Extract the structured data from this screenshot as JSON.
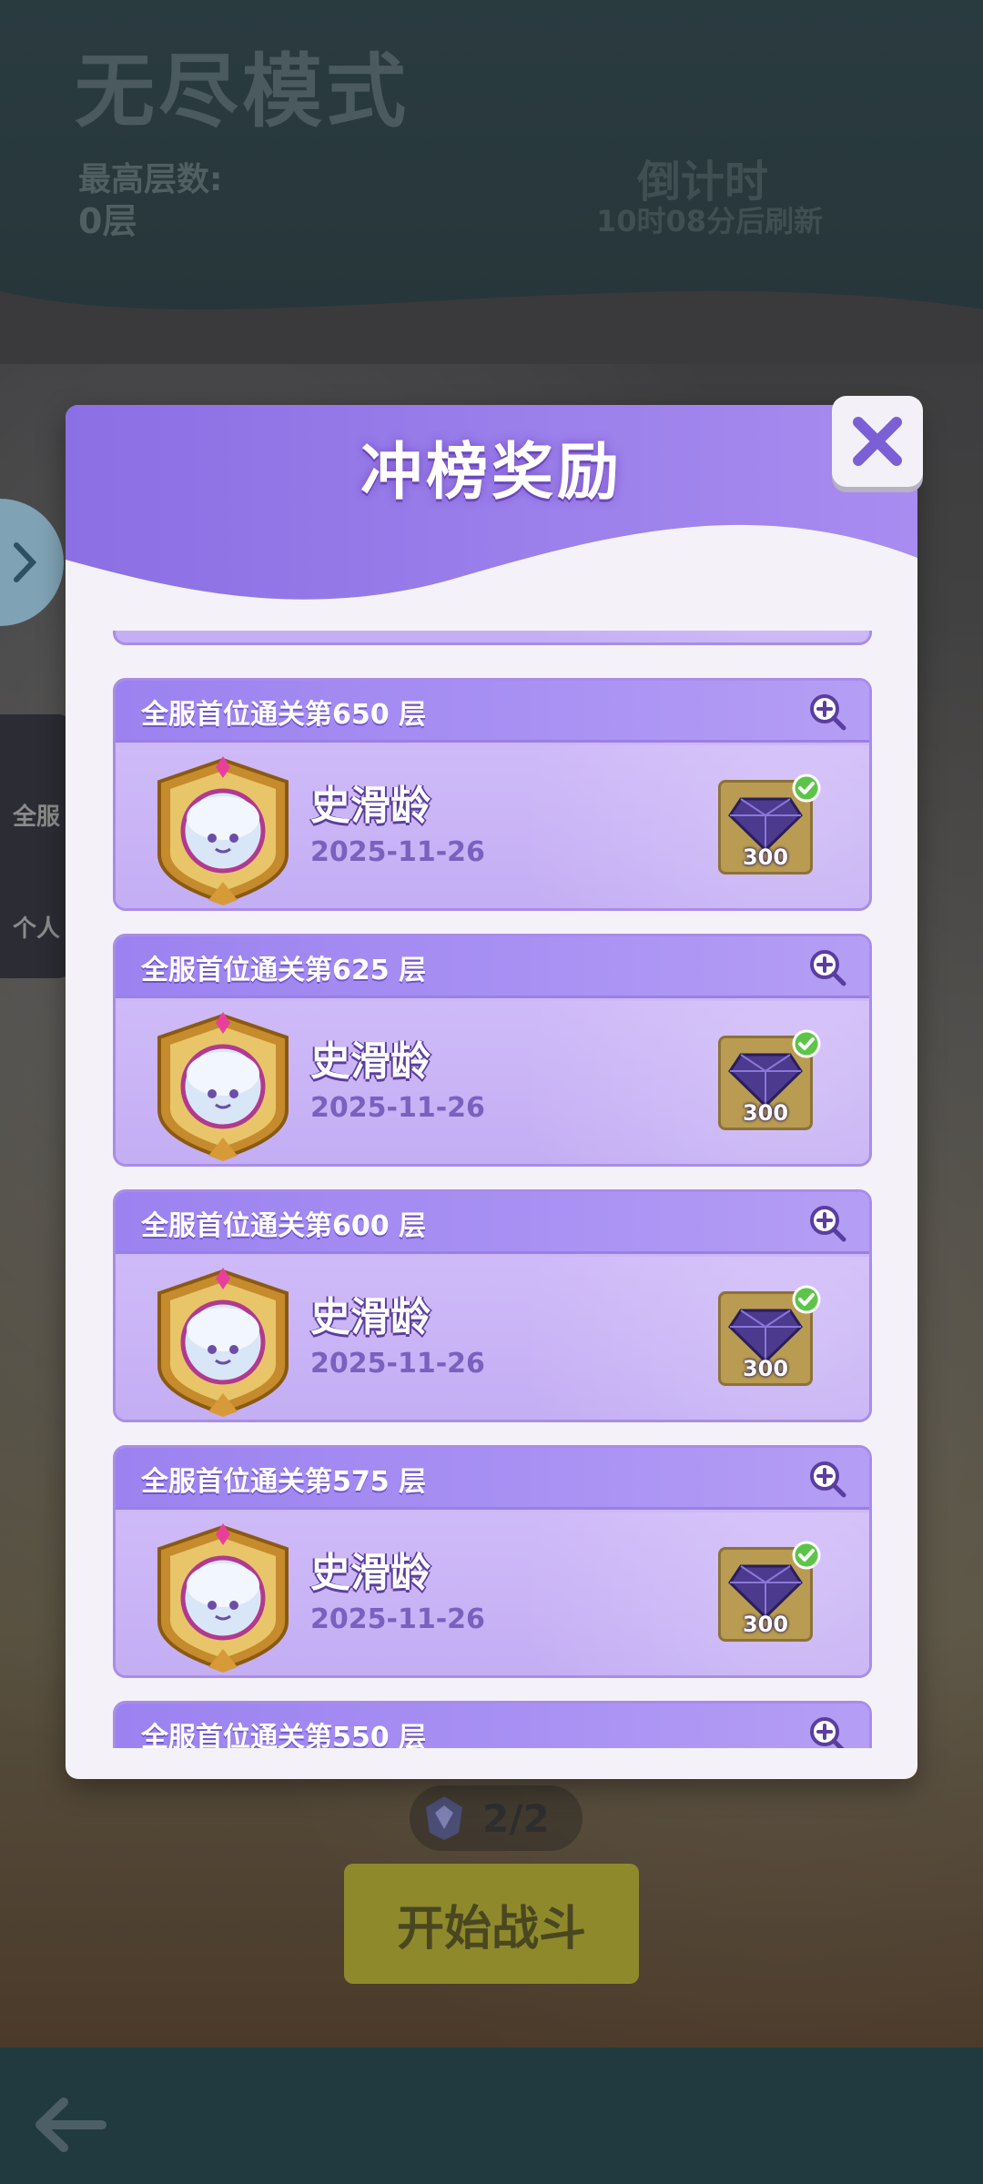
{
  "background": {
    "title": "无尽模式",
    "max_floor_label": "最高层数:",
    "max_floor_value": "0层",
    "countdown_label": "倒计时",
    "refresh_text": "10时08分后刷新",
    "side_labels": [
      "全服",
      "个人"
    ],
    "progress_count": "2/2",
    "start_button_label": "开始战斗"
  },
  "modal": {
    "title": "冲榜奖励",
    "close_icon": "close-icon",
    "items": [
      {
        "header": "全服首位通关第650 层",
        "name": "史滑龄",
        "date": "2025-11-26",
        "reward_qty": "300",
        "claimed": true
      },
      {
        "header": "全服首位通关第625 层",
        "name": "史滑龄",
        "date": "2025-11-26",
        "reward_qty": "300",
        "claimed": true
      },
      {
        "header": "全服首位通关第600 层",
        "name": "史滑龄",
        "date": "2025-11-26",
        "reward_qty": "300",
        "claimed": true
      },
      {
        "header": "全服首位通关第575 层",
        "name": "史滑龄",
        "date": "2025-11-26",
        "reward_qty": "300",
        "claimed": true
      },
      {
        "header": "全服首位通关第550 层",
        "name": "",
        "date": "",
        "reward_qty": "",
        "claimed": false
      }
    ]
  },
  "colors": {
    "accent": "#9b82f0",
    "card_bg": "#cdb8f7",
    "reward_tile": "#b99c52",
    "check_green": "#5cc548"
  }
}
